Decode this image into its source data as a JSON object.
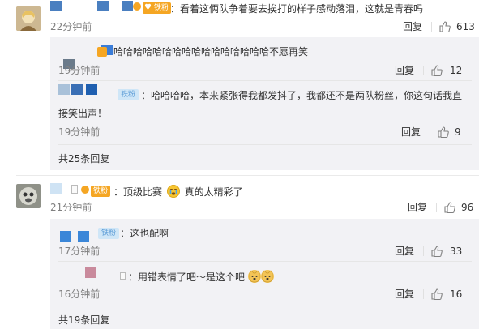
{
  "comments": [
    {
      "text": "：看着这俩队争着要去挨打的样子感动落泪，这就是青春吗",
      "time": "22分钟前",
      "reply_label": "回复",
      "likes": "613",
      "replies": [
        {
          "text": "哈哈哈哈哈哈哈哈哈哈哈哈哈哈哈哈不愿再笑",
          "time": "19分钟前",
          "reply_label": "回复",
          "likes": "12"
        },
        {
          "badge": "铁粉",
          "text_line1": "：哈哈哈哈，本来紧张得我都发抖了，我都还不是两队粉丝，你这句话我直",
          "text_line2": "接笑出声！",
          "time": "19分钟前",
          "reply_label": "回复",
          "likes": "9"
        }
      ],
      "more": "共25条回复"
    },
    {
      "badge": "铁粉",
      "text_a": "：顶级比赛",
      "text_b": "真的太精彩了",
      "time": "21分钟前",
      "reply_label": "回复",
      "likes": "96",
      "replies": [
        {
          "badge": "铁粉",
          "text": "：这也配啊",
          "time": "17分钟前",
          "reply_label": "回复",
          "likes": "33"
        },
        {
          "text": "：用错表情了吧～是这个吧",
          "time": "16分钟前",
          "reply_label": "回复",
          "likes": "16"
        }
      ],
      "more": "共19条回复"
    }
  ],
  "colors": {
    "badge_orange": "#f5a623",
    "badge_blue": "#cfe6f7",
    "sub_panel": "#f2f2f5"
  }
}
